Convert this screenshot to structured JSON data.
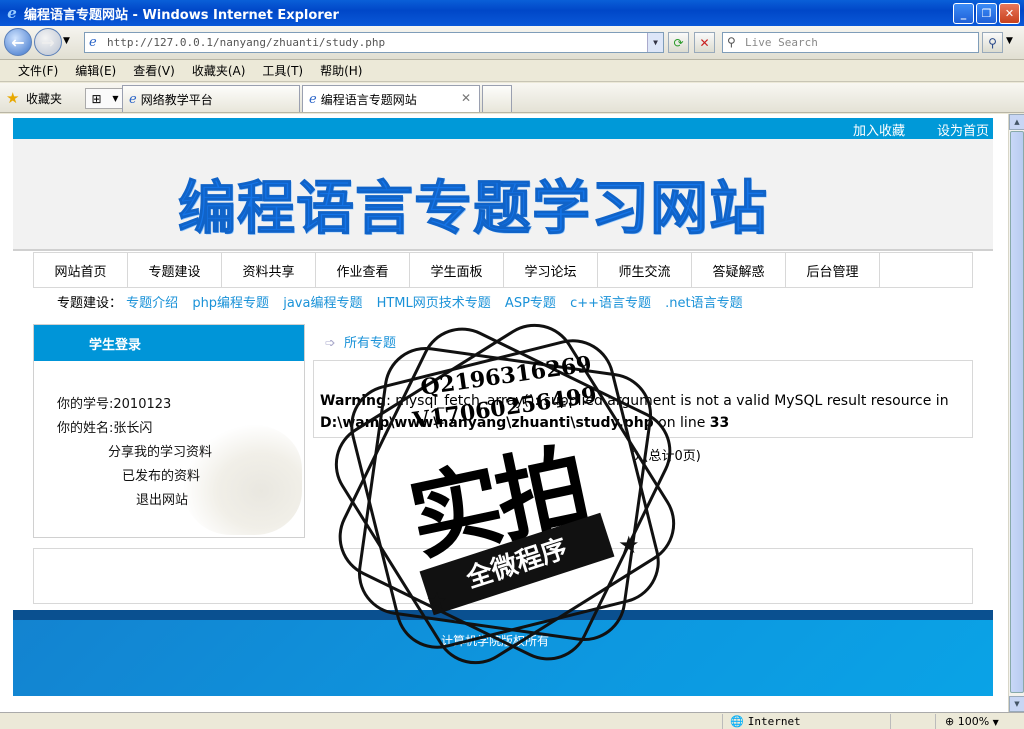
{
  "window": {
    "title": "编程语言专题网站 - Windows Internet Explorer"
  },
  "address": {
    "url": "http://127.0.0.1/nanyang/zhuanti/study.php",
    "search_placeholder": "Live Search"
  },
  "menu": [
    "文件(F)",
    "编辑(E)",
    "查看(V)",
    "收藏夹(A)",
    "工具(T)",
    "帮助(H)"
  ],
  "favorites": {
    "label": "收藏夹"
  },
  "tabs": [
    {
      "label": "网络教学平台",
      "active": false
    },
    {
      "label": "编程语言专题网站",
      "active": true
    }
  ],
  "page": {
    "top_links": [
      "加入收藏",
      "设为首页"
    ],
    "banner_title": "编程语言专题学习网站",
    "nav": [
      "网站首页",
      "专题建设",
      "资料共享",
      "作业查看",
      "学生面板",
      "学习论坛",
      "师生交流",
      "答疑解惑",
      "后台管理"
    ],
    "subnav": {
      "label": "专题建设：",
      "links": [
        "专题介绍",
        "php编程专题",
        "java编程专题",
        "HTML网页技术专题",
        "ASP专题",
        "c++语言专题",
        ".net语言专题"
      ]
    },
    "login": {
      "header": "学生登录",
      "student_id": "你的学号:2010123",
      "student_name": "你的姓名:张长闪",
      "share": "分享我的学习资料",
      "published": "已发布的资料",
      "logout": "退出网站"
    },
    "crumb": "所有专题",
    "warning": {
      "label": "Warning",
      "message": ": mysql_fetch_array(): supplied argument is not a valid MySQL result resource in",
      "path": "D:\\wamp\\www\\nanyang\\zhuanti\\study.php",
      "on_line": " on line ",
      "line": "33"
    },
    "page_info": "0 (总计0页)",
    "footer": "计算机学院版权所有"
  },
  "watermark": {
    "line1": "Q2196316269",
    "line2": "V17060256499",
    "big": "实拍",
    "band": "全微程序"
  },
  "status": {
    "zone": "Internet",
    "zoom": "100%"
  },
  "colors": {
    "accent": "#0099d8",
    "banner_text": "#1474e8",
    "link": "#1a92d8",
    "footer": "#0d98e0"
  }
}
